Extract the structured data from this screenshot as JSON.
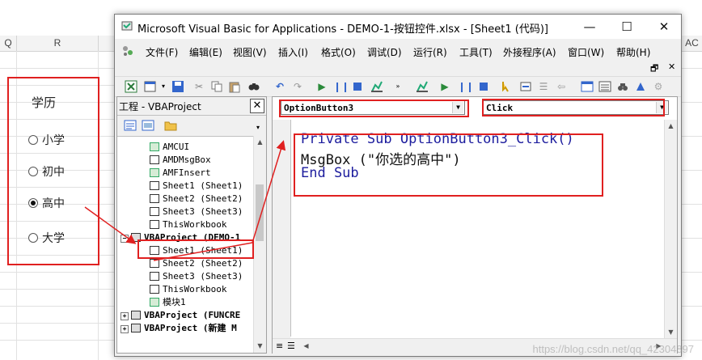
{
  "excel": {
    "col_headers": [
      "Q",
      "R",
      "AC"
    ],
    "group_title": "学历",
    "options": [
      {
        "label": "小学",
        "checked": false
      },
      {
        "label": "初中",
        "checked": false
      },
      {
        "label": "高中",
        "checked": true
      },
      {
        "label": "大学",
        "checked": false
      }
    ]
  },
  "window": {
    "title": "Microsoft Visual Basic for Applications - DEMO-1-按钮控件.xlsx - [Sheet1 (代码)]",
    "minimize": "—",
    "maximize": "☐",
    "close": "✕"
  },
  "menu": {
    "items": [
      "文件(F)",
      "编辑(E)",
      "视图(V)",
      "插入(I)",
      "格式(O)",
      "调试(D)",
      "运行(R)",
      "工具(T)",
      "外接程序(A)",
      "窗口(W)",
      "帮助(H)"
    ],
    "mdi_restore": "🗗",
    "mdi_close": "✕"
  },
  "project": {
    "title": "工程 - VBAProject",
    "close": "✕",
    "nodes": [
      {
        "label": "AMCUI",
        "type": "module"
      },
      {
        "label": "AMDMsgBox",
        "type": "form"
      },
      {
        "label": "AMFInsert",
        "type": "module"
      },
      {
        "label": "Sheet1 (Sheet1)",
        "type": "sheet"
      },
      {
        "label": "Sheet2 (Sheet2)",
        "type": "sheet"
      },
      {
        "label": "Sheet3 (Sheet3)",
        "type": "sheet"
      },
      {
        "label": "ThisWorkbook",
        "type": "sheet"
      },
      {
        "label": "VBAProject (DEMO-1",
        "type": "project"
      },
      {
        "label": "Sheet1 (Sheet1)",
        "type": "sheet"
      },
      {
        "label": "Sheet2 (Sheet2)",
        "type": "sheet"
      },
      {
        "label": "Sheet3 (Sheet3)",
        "type": "sheet"
      },
      {
        "label": "ThisWorkbook",
        "type": "sheet"
      },
      {
        "label": "模块1",
        "type": "module"
      },
      {
        "label": "VBAProject (FUNCRE",
        "type": "project"
      },
      {
        "label": "VBAProject (新建 M",
        "type": "project"
      }
    ]
  },
  "code": {
    "object": "OptionButton3",
    "procedure": "Click",
    "lines": [
      {
        "kw": "Private Sub",
        "rest": " OptionButton3_Click()"
      },
      {
        "kw": "",
        "rest": "MsgBox (\"你选的高中\")"
      },
      {
        "kw": "End Sub",
        "rest": ""
      }
    ]
  },
  "watermark": "https://blog.csdn.net/qq_42304897",
  "colors": {
    "annotation": "#e02020",
    "keyword": "#1d1d9e"
  }
}
